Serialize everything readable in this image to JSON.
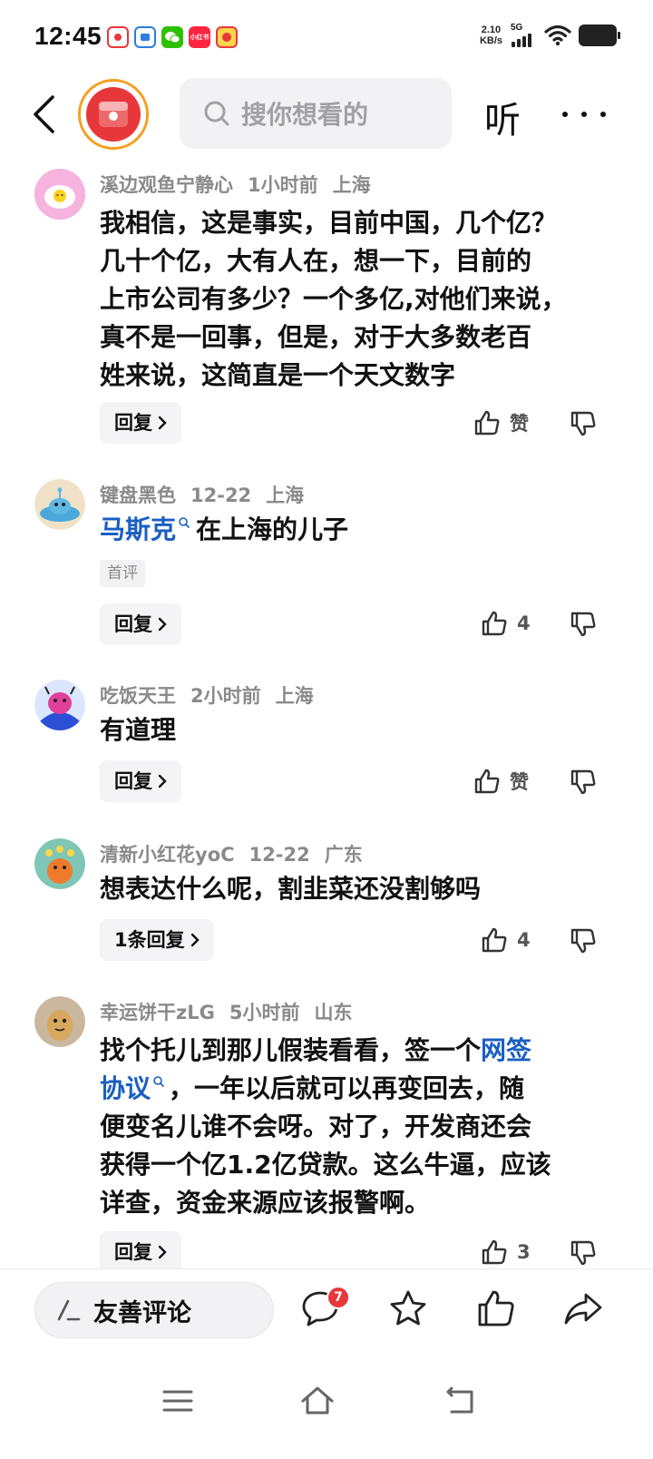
{
  "status_bar": {
    "time": "12:45",
    "app_icons": [
      "app-icon-1",
      "app-icon-2",
      "wechat-icon",
      "xiaohongshu-icon",
      "app-icon-5"
    ],
    "net_speed_value": "2.10",
    "net_speed_unit": "KB/s",
    "network": "5G",
    "signal_icon": "signal-icon",
    "wifi_icon": "wifi-icon",
    "battery_icon": "battery-icon"
  },
  "header": {
    "back_icon": "back-icon",
    "search_placeholder": "搜你想看的",
    "listen_label": "听",
    "more_icon": "more-icon"
  },
  "comments": [
    {
      "username": "溪边观鱼宁静心",
      "time": "1小时前",
      "location": "上海",
      "lines": [
        "我相信，这是事实，目前中国，几个亿？",
        "几十个亿，大有人在，想一下，目前的",
        "上市公司有多少？一个多亿,对他们来说，",
        "真不是一回事，但是，对于大多数老百",
        "姓来说，这简直是一个天文数字"
      ],
      "reply_label": "回复",
      "like_label": "赞"
    },
    {
      "username": "键盘黑色",
      "time": "12-22",
      "location": "上海",
      "link_text": "马斯克",
      "text_after_link": "在上海的儿子",
      "badge": "首评",
      "reply_label": "回复",
      "like_label": "4"
    },
    {
      "username": "吃饭天王",
      "time": "2小时前",
      "location": "上海",
      "text": "有道理",
      "reply_label": "回复",
      "like_label": "赞"
    },
    {
      "username": "清新小红花yoC",
      "time": "12-22",
      "location": "广东",
      "text": "想表达什么呢，割韭菜还没割够吗",
      "reply_label": "1条回复",
      "like_label": "4"
    },
    {
      "username": "幸运饼干zLG",
      "time": "5小时前",
      "location": "山东",
      "line1_text": "找个托儿到那儿假装看看，签一个",
      "line1_link": "网签",
      "line2_link": "协议",
      "line2_text": "，一年以后就可以再变回去，随",
      "lines_rest": [
        "便变名儿谁不会呀。对了，开发商还会",
        "获得一个亿1.2亿贷款。这么牛逼，应该",
        "详查，资金来源应该报警啊。"
      ],
      "reply_label": "回复",
      "like_label": "3"
    }
  ],
  "action_bar": {
    "comment_placeholder": "友善评论",
    "comment_count_badge": "7",
    "icons": [
      "comment-icon",
      "star-icon",
      "like-icon",
      "share-icon"
    ]
  },
  "nav_bar": {
    "icons": [
      "menu-icon",
      "home-icon",
      "back-nav-icon"
    ]
  },
  "colors": {
    "link": "#1a5ec2",
    "badge_red": "#e8373a",
    "meta_gray": "#8a8a8e"
  }
}
